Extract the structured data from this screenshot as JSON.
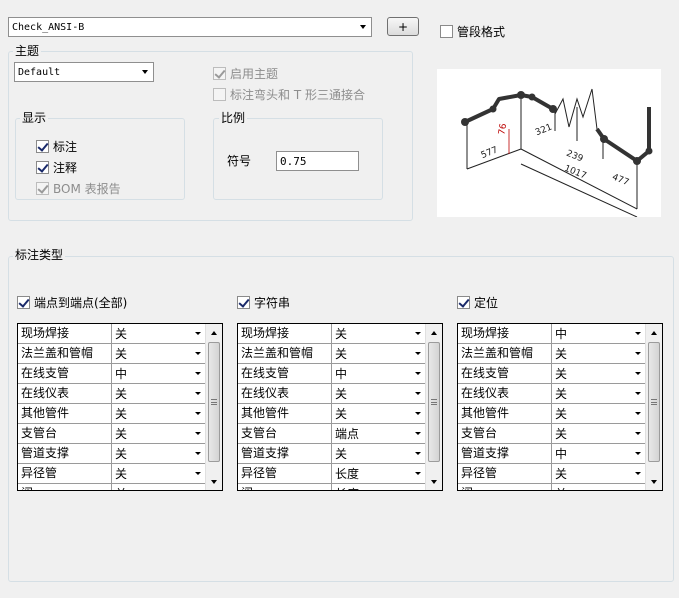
{
  "top": {
    "style_value": "Check_ANSI-B",
    "add_button": "+",
    "segment_format_label": "管段格式",
    "segment_format_checked": false
  },
  "theme": {
    "group_label": "主题",
    "theme_value": "Default",
    "enable_theme_label": "启用主题",
    "enable_theme_checked": true,
    "tee_label": "标注弯头和 T 形三通接合",
    "tee_checked": false
  },
  "display": {
    "group_label": "显示",
    "items": [
      {
        "label": "标注",
        "checked": true,
        "disabled": false
      },
      {
        "label": "注释",
        "checked": true,
        "disabled": false
      },
      {
        "label": "BOM 表报告",
        "checked": true,
        "disabled": true
      }
    ]
  },
  "scale": {
    "group_label": "比例",
    "symbol_label": "符号",
    "symbol_value": "0.75"
  },
  "preview": {
    "dims": [
      "76",
      "321",
      "577",
      "239",
      "1017",
      "477"
    ]
  },
  "annotation_types": {
    "group_label": "标注类型",
    "panels": [
      {
        "label": "端点到端点(全部)",
        "checked": true,
        "rows": [
          {
            "name": "现场焊接",
            "value": "关"
          },
          {
            "name": "法兰盖和管帽",
            "value": "关"
          },
          {
            "name": "在线支管",
            "value": "中"
          },
          {
            "name": "在线仪表",
            "value": "关"
          },
          {
            "name": "其他管件",
            "value": "关"
          },
          {
            "name": "支管台",
            "value": "关"
          },
          {
            "name": "管道支撑",
            "value": "关"
          },
          {
            "name": "异径管",
            "value": "关"
          },
          {
            "name": "阀",
            "value": "关"
          }
        ]
      },
      {
        "label": "字符串",
        "checked": true,
        "rows": [
          {
            "name": "现场焊接",
            "value": "关"
          },
          {
            "name": "法兰盖和管帽",
            "value": "关"
          },
          {
            "name": "在线支管",
            "value": "中"
          },
          {
            "name": "在线仪表",
            "value": "关"
          },
          {
            "name": "其他管件",
            "value": "关"
          },
          {
            "name": "支管台",
            "value": "端点"
          },
          {
            "name": "管道支撑",
            "value": "关"
          },
          {
            "name": "异径管",
            "value": "长度"
          },
          {
            "name": "阀",
            "value": "长度"
          }
        ]
      },
      {
        "label": "定位",
        "checked": true,
        "rows": [
          {
            "name": "现场焊接",
            "value": "中"
          },
          {
            "name": "法兰盖和管帽",
            "value": "关"
          },
          {
            "name": "在线支管",
            "value": "关"
          },
          {
            "name": "在线仪表",
            "value": "关"
          },
          {
            "name": "其他管件",
            "value": "关"
          },
          {
            "name": "支管台",
            "value": "关"
          },
          {
            "name": "管道支撑",
            "value": "中"
          },
          {
            "name": "异径管",
            "value": "关"
          },
          {
            "name": "阀",
            "value": "关"
          }
        ]
      }
    ]
  }
}
